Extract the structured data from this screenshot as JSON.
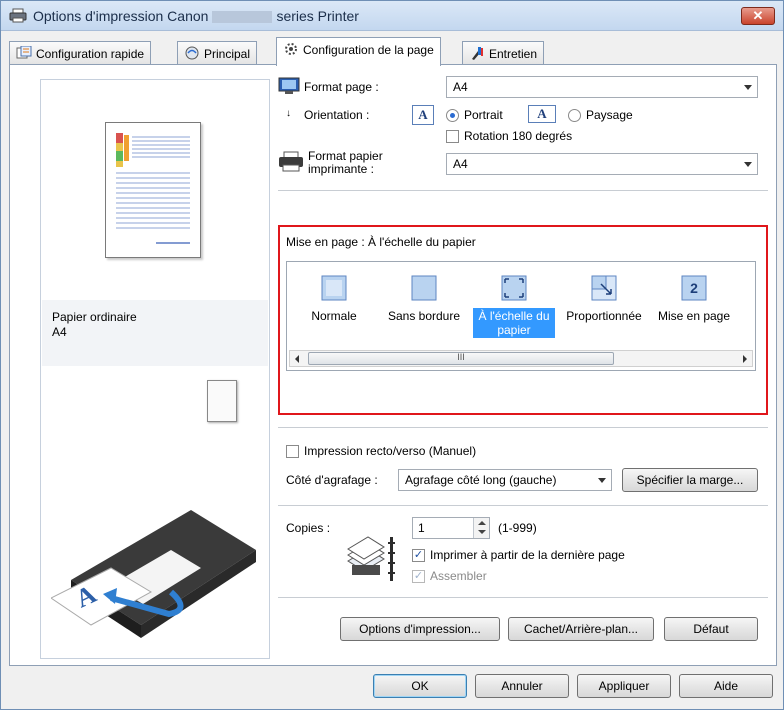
{
  "window": {
    "title_prefix": "Options d'impression Canon",
    "title_suffix": "series Printer",
    "close_glyph": "✕"
  },
  "tabs": [
    {
      "label": "Configuration rapide",
      "icon": "quick-setup-icon"
    },
    {
      "label": "Principal",
      "icon": "main-icon"
    },
    {
      "label": "Configuration de la page",
      "icon": "page-setup-icon"
    },
    {
      "label": "Entretien",
      "icon": "maintenance-icon"
    }
  ],
  "preview": {
    "media_type": "Papier ordinaire",
    "paper_size": "A4"
  },
  "page_size": {
    "label": "Format page :",
    "value": "A4"
  },
  "orientation": {
    "label": "Orientation :",
    "portrait_label": "Portrait",
    "landscape_label": "Paysage",
    "selected": "portrait",
    "rotate_label": "Rotation 180 degrés",
    "rotate_checked": false,
    "glyph": "A"
  },
  "printer_paper_size": {
    "label_line1": "Format papier",
    "label_line2": "imprimante :",
    "value": "A4"
  },
  "page_layout": {
    "label": "Mise en page : À l'échelle du papier",
    "items": [
      {
        "label": "Normale",
        "icon": "normal-layout-icon"
      },
      {
        "label": "Sans bordure",
        "icon": "borderless-layout-icon"
      },
      {
        "label_line1": "À l'échelle du",
        "label_line2": "papier",
        "icon": "fit-to-page-icon",
        "selected": true
      },
      {
        "label": "Proportionnée",
        "icon": "scaled-layout-icon"
      },
      {
        "label": "Mise en page",
        "icon": "page-layout-icon",
        "badge": "2"
      }
    ],
    "scroll_grip": "III"
  },
  "duplex": {
    "label": "Impression recto/verso (Manuel)",
    "checked": false
  },
  "stapling": {
    "label": "Côté d'agrafage :",
    "value": "Agrafage côté long (gauche)",
    "margin_button": "Spécifier la marge..."
  },
  "copies": {
    "label": "Copies :",
    "value": "1",
    "range": "(1-999)",
    "reverse_label": "Imprimer à partir de la dernière page",
    "reverse_checked": true,
    "collate_label": "Assembler",
    "collate_checked": true,
    "collate_enabled": false
  },
  "panel_buttons": {
    "print_options": "Options d'impression...",
    "stamp_background": "Cachet/Arrière-plan...",
    "defaults": "Défaut"
  },
  "dialog_buttons": {
    "ok": "OK",
    "cancel": "Annuler",
    "apply": "Appliquer",
    "help": "Aide"
  },
  "colors": {
    "highlight_border": "#e0161b",
    "selection": "#3399ff"
  }
}
